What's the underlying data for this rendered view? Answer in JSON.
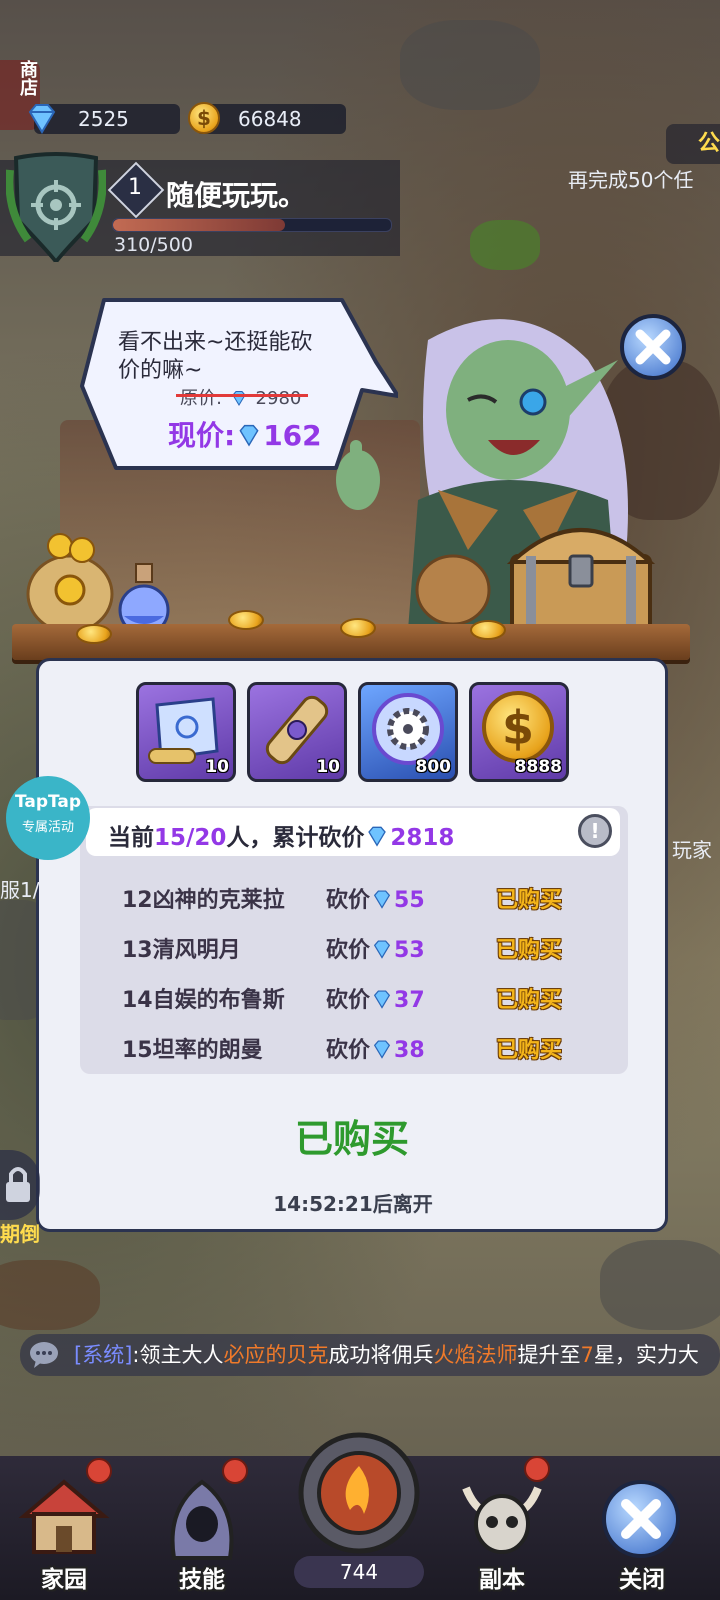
{
  "top_bar": {
    "left_cut_label": "商店",
    "gems": "2525",
    "gold": "66848",
    "coin_symbol": "$"
  },
  "player": {
    "level": "1",
    "title": "随便玩玩。",
    "progress_text": "310/500",
    "progress": 0.62
  },
  "quest_hint": "再完成50个任",
  "corner_badge": "公",
  "speech": {
    "line1": "看不出来~还挺能砍",
    "line2": "价的嘛~",
    "original_label": "原价:",
    "original_value": "2980",
    "current_label": "现价:",
    "current_value": "162"
  },
  "rewards": [
    {
      "icon": "scroll-icon",
      "count": "10"
    },
    {
      "icon": "rolled-scroll-icon",
      "count": "10"
    },
    {
      "icon": "saw-blade-orb-icon",
      "count": "800"
    },
    {
      "icon": "gold-coin-icon",
      "count": "8888",
      "symbol": "$"
    }
  ],
  "summary": {
    "prefix": "当前",
    "count": "15/20",
    "middle": "人，累计砍价",
    "total": "2818"
  },
  "bargain_rows": [
    {
      "name": "12凶神的克莱拉",
      "label": "砍价",
      "value": "55",
      "status": "已购买"
    },
    {
      "name": "13清风明月",
      "label": "砍价",
      "value": "53",
      "status": "已购买"
    },
    {
      "name": "14自娱的布鲁斯",
      "label": "砍价",
      "value": "37",
      "status": "已购买"
    },
    {
      "name": "15坦率的朗曼",
      "label": "砍价",
      "value": "38",
      "status": "已购买"
    }
  ],
  "purchased_button": "已购买",
  "timer": "14:52:21后离开",
  "taptap": {
    "brand": "TapTap",
    "sub": "专属活动"
  },
  "side_labels": {
    "left_mid": "服1/",
    "left_low": "期倒",
    "right_mid": "玩家"
  },
  "chat": {
    "tag": "[系统]",
    "sep": ":",
    "part1": "领主大人",
    "player": "必应的贝克",
    "part2": "成功将佣兵",
    "mercenary": "火焰法师",
    "part3": "提升至",
    "star": "7",
    "part4": "星，实力大"
  },
  "nav": {
    "home": "家园",
    "skill": "技能",
    "center_value": "744",
    "dungeon": "副本",
    "close": "关闭"
  },
  "colors": {
    "accent_purple": "#9338e6",
    "panel_bg": "#eef0f7",
    "status_gold": "#f4b51a",
    "button_green": "#2e9a2e",
    "old_price_red": "#e23a3a",
    "chat_orange": "#f07a2a"
  }
}
